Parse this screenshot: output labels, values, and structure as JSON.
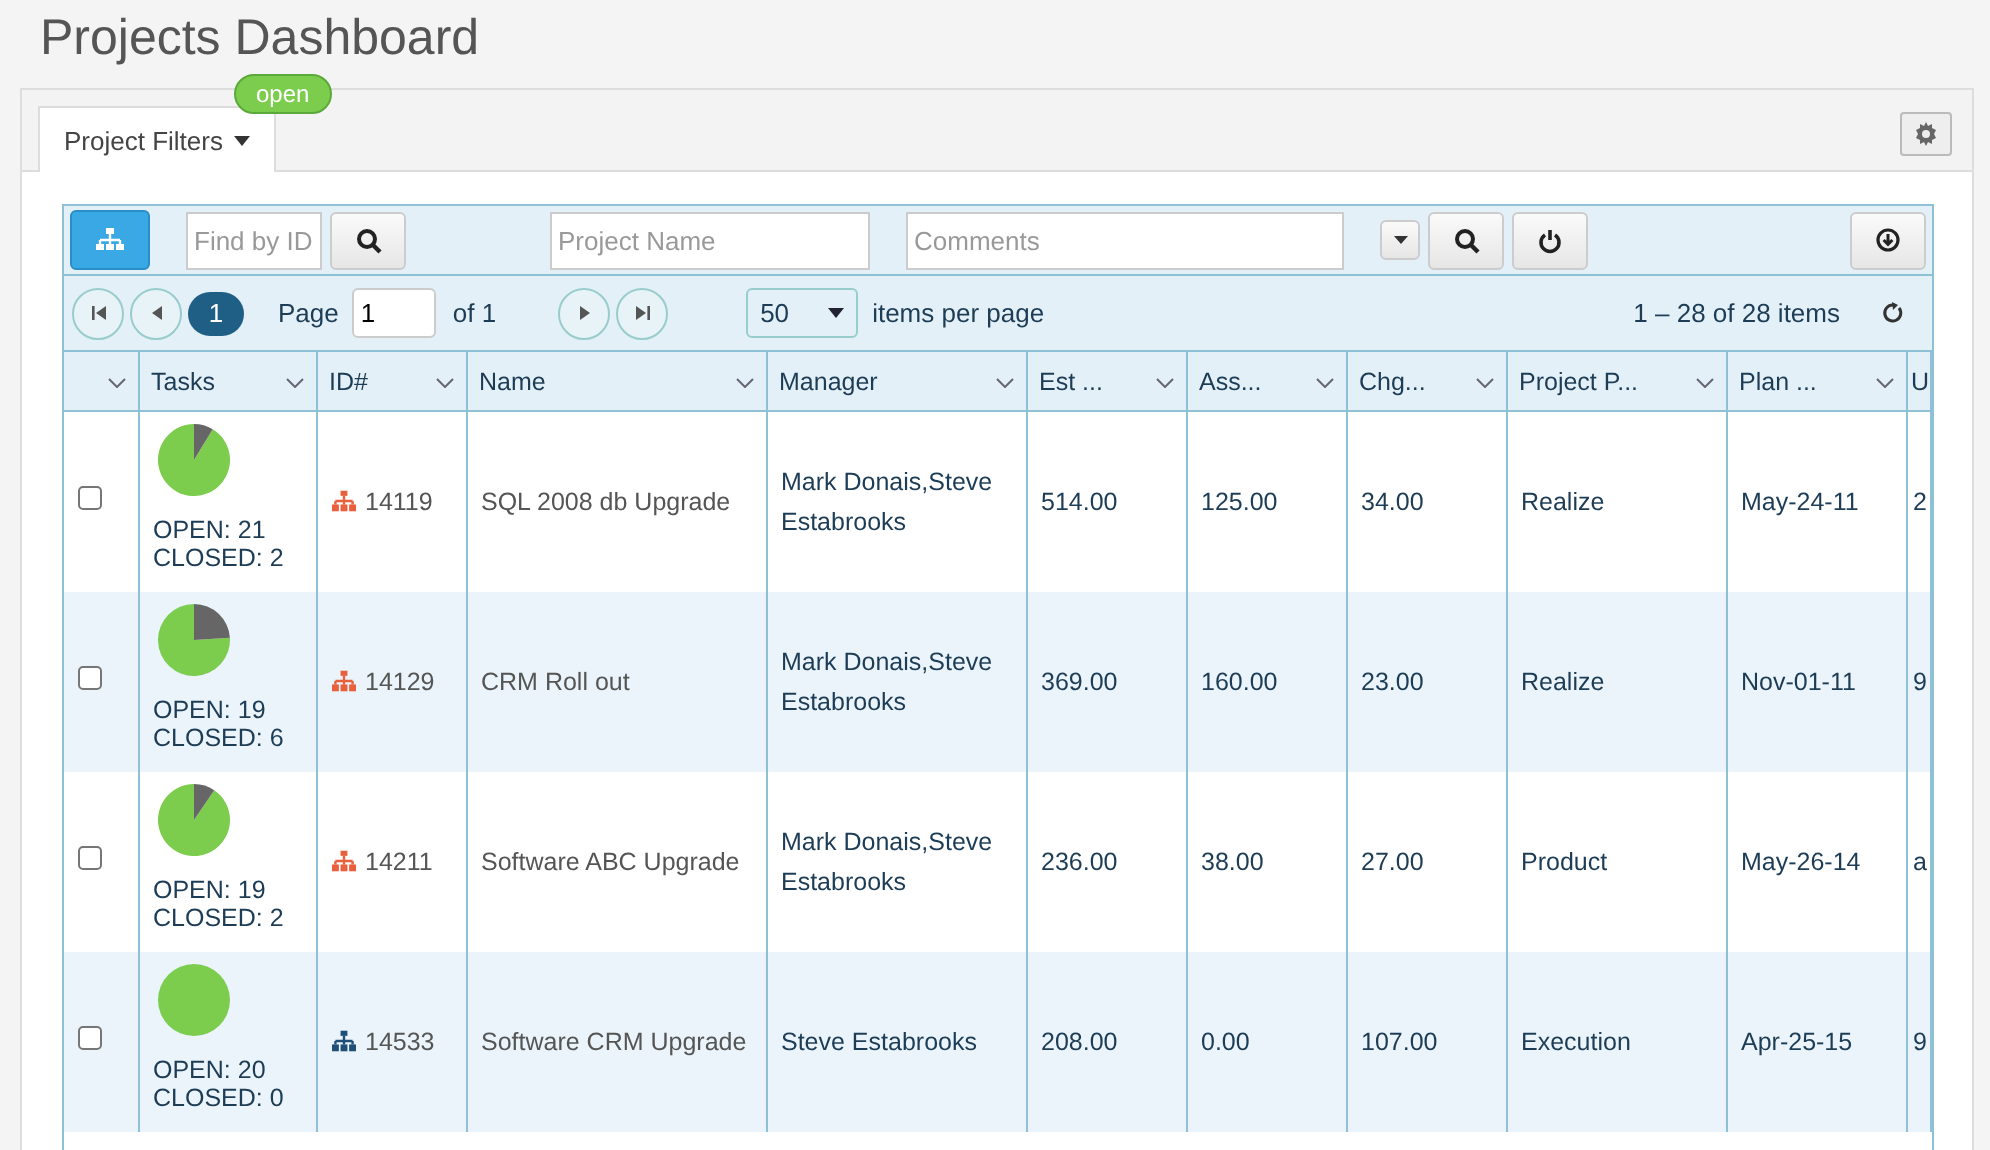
{
  "page_title": "Projects Dashboard",
  "tab": {
    "label": "Project Filters",
    "badge": "open",
    "selected": true
  },
  "toolbar": {
    "find_placeholder": "Find by ID",
    "name_placeholder": "Project Name",
    "comments_placeholder": "Comments"
  },
  "pager": {
    "pages": [
      {
        "label": "1",
        "selected": true
      }
    ],
    "page_label": "Page",
    "page_value": "1",
    "of_label": "of 1",
    "per_page": "50",
    "per_page_label": "items per page",
    "summary": "1 – 28 of 28 items"
  },
  "table": {
    "columns": [
      "",
      "Tasks",
      "ID#",
      "Name",
      "Manager",
      "Est ...",
      "Ass...",
      "Chg...",
      "Project P...",
      "Plan ...",
      "U"
    ],
    "rows": [
      {
        "checked": false,
        "chart_data": {
          "type": "pie",
          "values": [
            91.3,
            8.7
          ]
        },
        "open": "OPEN: 21",
        "closed": "CLOSED: 2",
        "color": "#e8603c",
        "id": "14119",
        "name": "SQL 2008 db Upgrade",
        "manager": "Mark Donais,Steve Estabrooks",
        "est": "514.00",
        "ass": "125.00",
        "chg": "34.00",
        "phase": "Realize",
        "plan": "May-24-11",
        "column_11": "2"
      },
      {
        "checked": false,
        "chart_data": {
          "type": "pie",
          "values": [
            76,
            24
          ]
        },
        "open": "OPEN: 19",
        "closed": "CLOSED: 6",
        "color": "#e8603c",
        "id": "14129",
        "name": "CRM Roll out",
        "manager": "Mark Donais,Steve Estabrooks",
        "est": "369.00",
        "ass": "160.00",
        "chg": "23.00",
        "phase": "Realize",
        "plan": "Nov-01-11",
        "column_11": "9"
      },
      {
        "checked": false,
        "chart_data": {
          "type": "pie",
          "values": [
            90.5,
            9.5
          ]
        },
        "open": "OPEN: 19",
        "closed": "CLOSED: 2",
        "color": "#e8603c",
        "id": "14211",
        "name": "Software ABC Upgrade",
        "manager": "Mark Donais,Steve Estabrooks",
        "est": "236.00",
        "ass": "38.00",
        "chg": "27.00",
        "phase": "Product",
        "plan": "May-26-14",
        "column_11": "a"
      },
      {
        "checked": false,
        "chart_data": {
          "type": "pie",
          "values": [
            100,
            0
          ]
        },
        "open": "OPEN: 20",
        "closed": "CLOSED: 0",
        "color": "#1f4e79",
        "id": "14533",
        "name": "Software CRM Upgrade",
        "manager": "Steve Estabrooks",
        "est": "208.00",
        "ass": "0.00",
        "chg": "107.00",
        "phase": "Execution",
        "plan": "Apr-25-15",
        "column_11": "9"
      }
    ]
  }
}
